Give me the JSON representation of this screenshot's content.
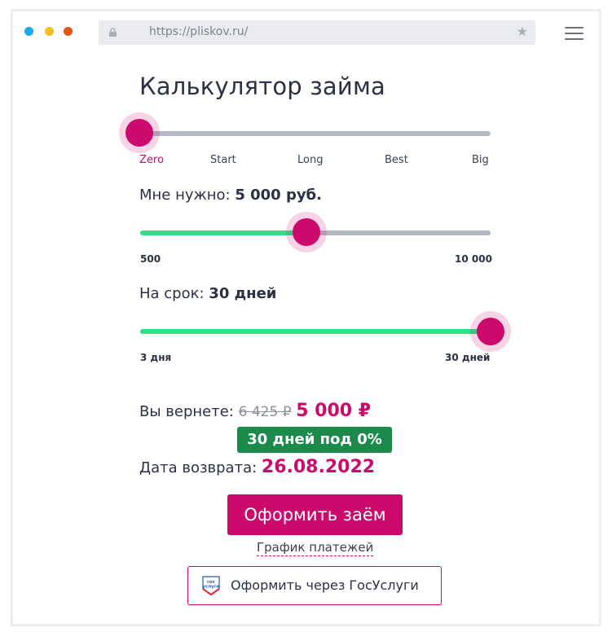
{
  "browser": {
    "url": "https://pliskov.ru/",
    "traffic_lights": [
      "#1aa9ea",
      "#f4be1e",
      "#e25418"
    ]
  },
  "calculator": {
    "title": "Калькулятор займа",
    "products": {
      "items": [
        "Zero",
        "Start",
        "Long",
        "Best",
        "Big"
      ],
      "selected_index": 0
    },
    "amount": {
      "label": "Мне нужно:",
      "value_text": "5 000 руб.",
      "min_label": "500",
      "max_label": "10 000",
      "value": 5000,
      "min": 500,
      "max": 10000
    },
    "term": {
      "label": "На срок:",
      "value_text": "30 дней",
      "min_label": "3 дня",
      "max_label": "30 дней",
      "value": 30,
      "min": 3,
      "max": 30
    },
    "return": {
      "label": "Вы вернете:",
      "old_amount": "6 425 ₽",
      "new_amount": "5 000 ₽"
    },
    "promo_badge": "30 дней под 0%",
    "return_date": {
      "label": "Дата возврата:",
      "value": "26.08.2022"
    },
    "submit_label": "Оформить заём",
    "schedule_link": "График платежей",
    "gosuslugi": {
      "label": "Оформить через ГосУслуги",
      "logo_text": "гос услуги"
    }
  },
  "colors": {
    "accent": "#cb0a6c",
    "slider_fill": "#2de286",
    "slider_track": "#b3b8c4",
    "promo_bg": "#1b8a4a"
  }
}
